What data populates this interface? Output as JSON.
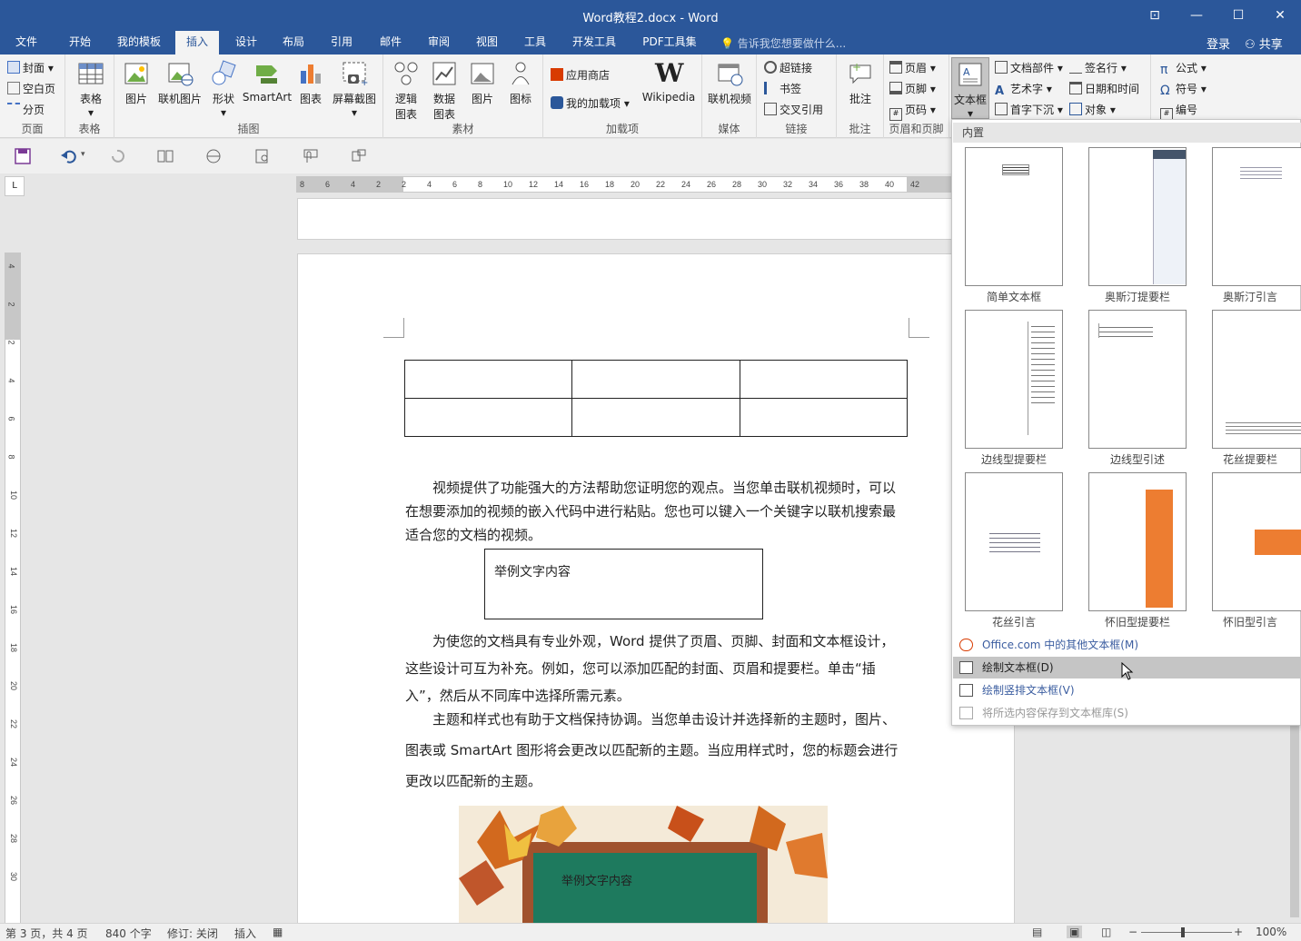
{
  "window": {
    "title": "Word教程2.docx - Word"
  },
  "tabs": {
    "items": [
      {
        "label": "文件"
      },
      {
        "label": "开始"
      },
      {
        "label": "我的模板"
      },
      {
        "label": "插入"
      },
      {
        "label": "设计"
      },
      {
        "label": "布局"
      },
      {
        "label": "引用"
      },
      {
        "label": "邮件"
      },
      {
        "label": "审阅"
      },
      {
        "label": "视图"
      },
      {
        "label": "工具"
      },
      {
        "label": "开发工具"
      },
      {
        "label": "PDF工具集"
      }
    ],
    "active": "插入",
    "tellme": "告诉我您想要做什么...",
    "login": "登录",
    "share": "共享"
  },
  "ribbon": {
    "page_group": {
      "label": "页面",
      "cover": "封面",
      "blank": "空白页",
      "break": "分页"
    },
    "table_group": {
      "label": "表格",
      "table": "表格"
    },
    "illus_group": {
      "label": "插图",
      "picture": "图片",
      "online_picture": "联机图片",
      "shapes": "形状",
      "smartart": "SmartArt",
      "chart": "图表",
      "screenshot": "屏幕截图"
    },
    "material_group": {
      "label": "素材",
      "logic": "逻辑图表",
      "data": "数据图表",
      "picture": "图片",
      "icon": "图标"
    },
    "addins_group": {
      "label": "加载项",
      "store": "应用商店",
      "myaddins": "我的加载项",
      "wikipedia": "Wikipedia"
    },
    "media_group": {
      "label": "媒体",
      "video": "联机视频"
    },
    "links_group": {
      "label": "链接",
      "hyperlink": "超链接",
      "bookmark": "书签",
      "crossref": "交叉引用"
    },
    "comment_group": {
      "label": "批注",
      "comment": "批注"
    },
    "hf_group": {
      "label": "页眉和页脚",
      "header": "页眉",
      "footer": "页脚",
      "pagenum": "页码"
    },
    "text_group": {
      "textbox": "文本框",
      "quickparts": "文档部件",
      "wordart": "艺术字",
      "dropcap": "首字下沉",
      "signature": "签名行",
      "datetime": "日期和时间",
      "object": "对象"
    },
    "symbol_group": {
      "equation": "公式",
      "symbol": "符号",
      "number": "编号"
    }
  },
  "ruler": {
    "h_ticks": [
      "8",
      "6",
      "4",
      "2",
      "2",
      "4",
      "6",
      "8",
      "10",
      "12",
      "14",
      "16",
      "18",
      "20",
      "22",
      "24",
      "26",
      "28",
      "30",
      "32",
      "34",
      "36",
      "38",
      "40",
      "42"
    ],
    "v_ticks": [
      "4",
      "2",
      "2",
      "4",
      "6",
      "8",
      "10",
      "12",
      "14",
      "16",
      "18",
      "20",
      "22",
      "24",
      "26",
      "28",
      "30"
    ],
    "corner": "L"
  },
  "document": {
    "para1": "视频提供了功能强大的方法帮助您证明您的观点。当您单击联机视频时，可以在想要添加的视频的嵌入代码中进行粘贴。您也可以键入一个关键字以联机搜索最适合您的文档的视频。",
    "textbox1": "举例文字内容",
    "para2": "为使您的文档具有专业外观，Word 提供了页眉、页脚、封面和文本框设计，这些设计可互为补充。例如，您可以添加匹配的封面、页眉和提要栏。单击“插入”，然后从不同库中选择所需元素。",
    "para3": "主题和样式也有助于文档保持协调。当您单击设计并选择新的主题时，图片、图表或 SmartArt 图形将会更改以匹配新的主题。当应用样式时，您的标题会进行更改以匹配新的主题。",
    "picture_text": "举例文字内容"
  },
  "gallery": {
    "header": "内置",
    "items": [
      {
        "label": "简单文本框"
      },
      {
        "label": "奥斯汀提要栏"
      },
      {
        "label": "奥斯汀引言"
      },
      {
        "label": "边线型提要栏"
      },
      {
        "label": "边线型引述"
      },
      {
        "label": "花丝提要栏"
      },
      {
        "label": "花丝引言"
      },
      {
        "label": "怀旧型提要栏"
      },
      {
        "label": "怀旧型引言"
      }
    ],
    "menu": [
      {
        "label": "Office.com 中的其他文本框(M)"
      },
      {
        "label": "绘制文本框(D)"
      },
      {
        "label": "绘制竖排文本框(V)"
      },
      {
        "label": "将所选内容保存到文本框库(S)"
      }
    ]
  },
  "status": {
    "page": "第 3 页，共 4 页",
    "words": "840 个字",
    "track": "修订: 关闭",
    "mode": "插入",
    "zoom": "100%"
  },
  "colors": {
    "brand": "#2b579a",
    "accent_orange": "#ed7d31"
  }
}
